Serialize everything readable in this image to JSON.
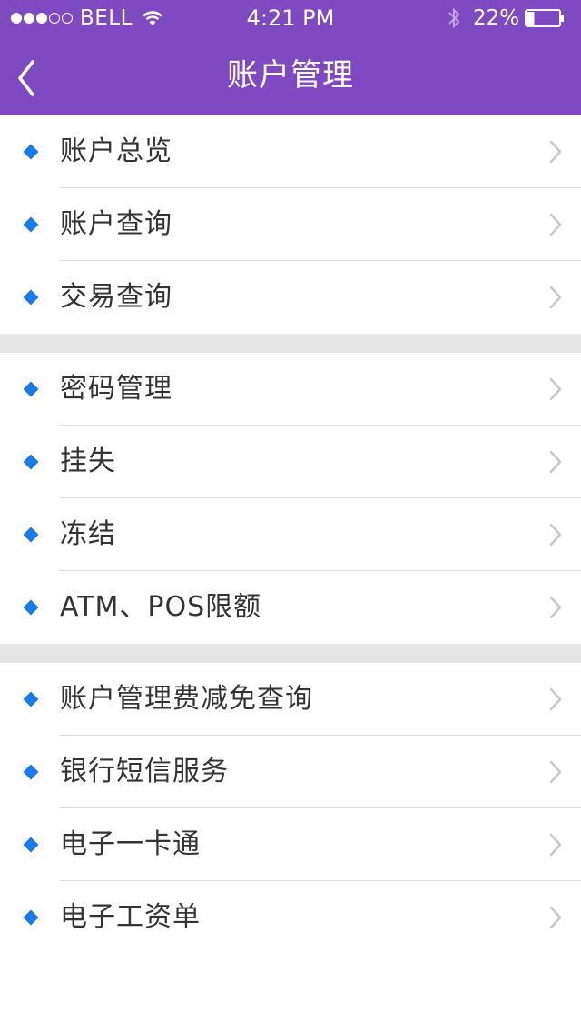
{
  "status_bar": {
    "carrier": "BELL",
    "time": "4:21 PM",
    "battery_percent": "22%",
    "battery_level": 0.22,
    "signal_bars": 3,
    "signal_total": 5
  },
  "header": {
    "title": "账户管理",
    "background": "#7e49c1"
  },
  "menu": {
    "groups": [
      {
        "items": [
          {
            "label": "账户总览"
          },
          {
            "label": "账户查询"
          },
          {
            "label": "交易查询"
          }
        ]
      },
      {
        "items": [
          {
            "label": "密码管理"
          },
          {
            "label": "挂失"
          },
          {
            "label": "冻结"
          },
          {
            "label": "ATM、POS限额"
          }
        ]
      },
      {
        "items": [
          {
            "label": "账户管理费减免查询"
          },
          {
            "label": "银行短信服务"
          },
          {
            "label": "电子一卡通"
          },
          {
            "label": "电子工资单"
          }
        ]
      }
    ]
  },
  "icons": {
    "bullet": "diamond-bullet-icon",
    "chevron": "chevron-right-icon",
    "back": "back-arrow-icon"
  },
  "colors": {
    "accent": "#7e49c1",
    "bullet": "#1a7ae6",
    "chevron": "#c7c7cc",
    "group_gap": "#e6e6e6"
  }
}
